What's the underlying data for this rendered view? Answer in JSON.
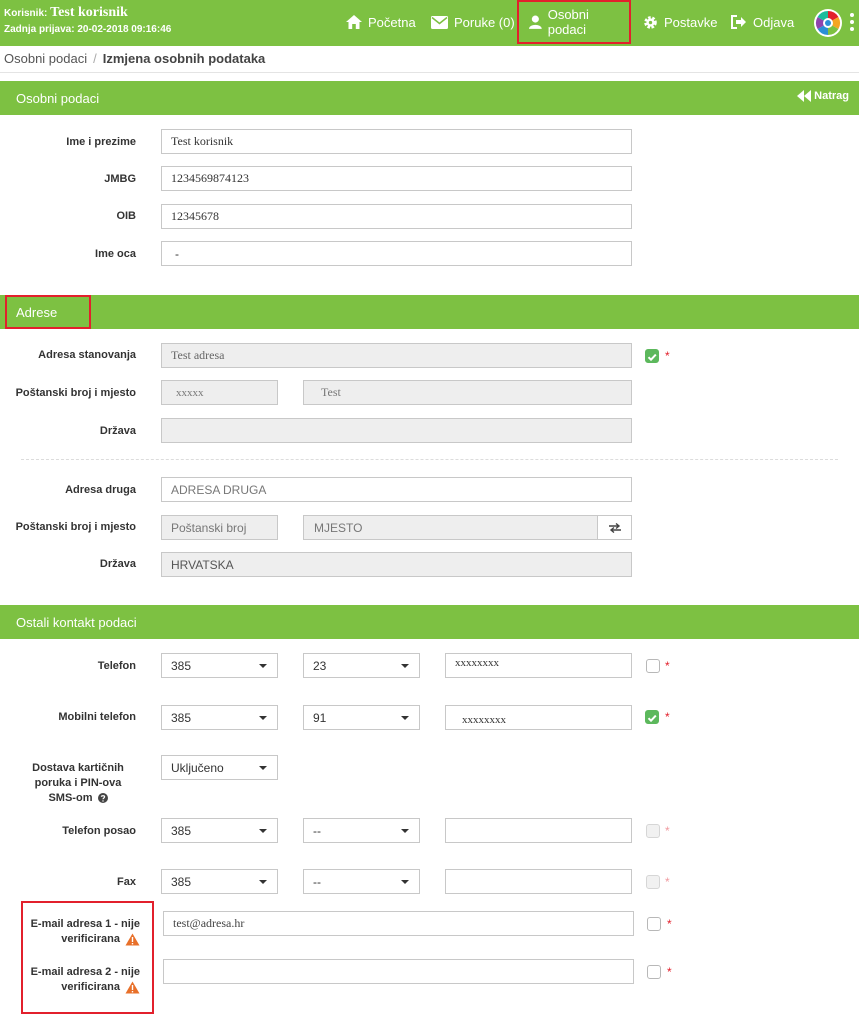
{
  "header": {
    "user_label": "Korisnik:",
    "user_name": "Test korisnik",
    "last_login": "Zadnja prijava: 20-02-2018 09:16:46",
    "nav": [
      {
        "label": "Početna",
        "icon": "home-icon"
      },
      {
        "label": "Poruke (0)",
        "icon": "envelope-icon"
      },
      {
        "label": "Osobni podaci",
        "icon": "user-icon",
        "active": true
      },
      {
        "label": "Postavke",
        "icon": "gear-icon"
      },
      {
        "label": "Odjava",
        "icon": "sign-out-icon"
      }
    ]
  },
  "breadcrumb": {
    "root": "Osobni podaci",
    "current": "Izmjena osobnih podataka"
  },
  "sections": {
    "personal": {
      "title": "Osobni podaci",
      "back_label": "Natrag"
    },
    "addresses": {
      "title": "Adrese"
    },
    "contacts": {
      "title": "Ostali kontakt podaci"
    }
  },
  "personal": {
    "name_label": "Ime i prezime",
    "name_value": "Test korisnik",
    "jmbg_label": "JMBG",
    "jmbg_value": "1234569874123",
    "oib_label": "OIB",
    "oib_value": "12345678",
    "father_label": "Ime oca",
    "father_value": "-"
  },
  "address_home": {
    "address_label": "Adresa stanovanja",
    "address_value": "Test adresa",
    "postal_label": "Poštanski broj i mjesto",
    "postal_value": "xxxxx",
    "city_value": "Test",
    "country_label": "Država",
    "country_value": ""
  },
  "address_other": {
    "address_label": "Adresa druga",
    "address_placeholder": "ADRESA DRUGA",
    "postal_label": "Poštanski broj i mjesto",
    "postal_placeholder": "Poštanski broj",
    "city_placeholder": "MJESTO",
    "country_label": "Država",
    "country_value": "HRVATSKA"
  },
  "contacts": {
    "phone_label": "Telefon",
    "phone_country": "385",
    "phone_area": "23",
    "phone_number": "xxxxxxxx",
    "mobile_label": "Mobilni telefon",
    "mobile_country": "385",
    "mobile_area": "91",
    "mobile_number": "xxxxxxxx",
    "sms_label": "Dostava kartičnih poruka i PIN-ova SMS-om",
    "sms_value": "Uključeno",
    "work_label": "Telefon posao",
    "work_country": "385",
    "work_area": "--",
    "work_number": "",
    "fax_label": "Fax",
    "fax_country": "385",
    "fax_area": "--",
    "fax_number": "",
    "email1_label": "E-mail adresa 1 - nije verificirana",
    "email1_value": "test@adresa.hr",
    "email2_label": "E-mail adresa 2 - nije verificirana",
    "email2_value": "",
    "required_mark": "*"
  },
  "colors": {
    "brand_green": "#7dc142",
    "highlight_red": "#e2202c",
    "check_green": "#5cb85c",
    "warn_orange": "#e8702a"
  }
}
